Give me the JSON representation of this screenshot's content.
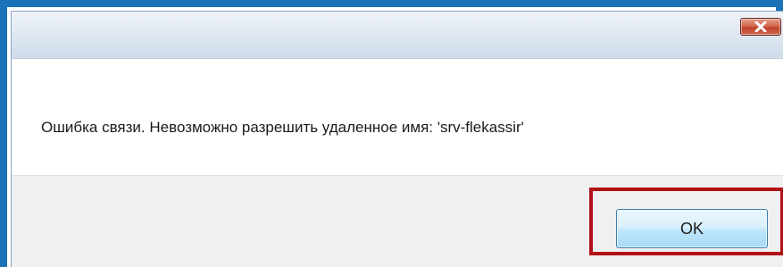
{
  "dialog": {
    "title": "",
    "close_icon": "close-icon",
    "message": "Ошибка связи. Невозможно разрешить удаленное имя: 'srv-flekassir'",
    "ok_label": "OK"
  },
  "colors": {
    "frame_blue": "#1a73b8",
    "highlight_red": "#b01217",
    "close_red": "#c0432c",
    "button_face": "#bee6fd"
  }
}
